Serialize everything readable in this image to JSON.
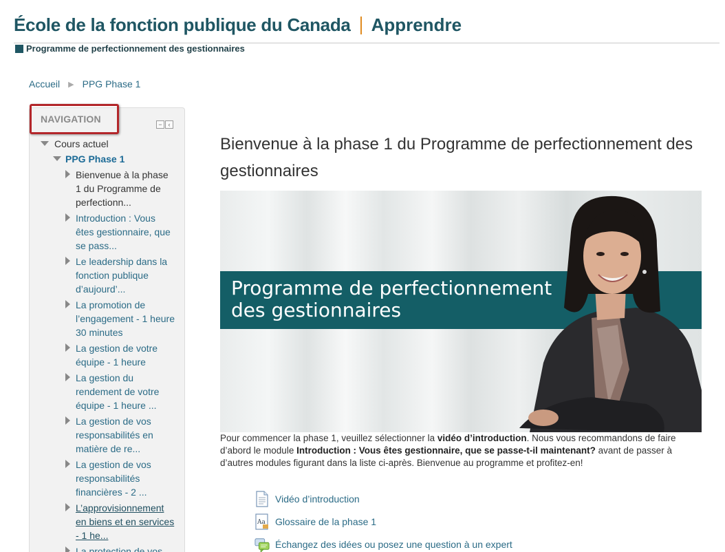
{
  "header": {
    "org_name": "École de la fonction publique du Canada",
    "app_name": "Apprendre",
    "program": "Programme de perfectionnement des gestionnaires"
  },
  "breadcrumb": {
    "home": "Accueil",
    "current": "PPG Phase 1"
  },
  "navigation": {
    "title": "NAVIGATION",
    "current_course_label": "Cours actuel",
    "course_link": "PPG Phase 1",
    "sections": [
      {
        "label": "Bienvenue à la phase 1 du Programme de perfectionn...",
        "style": "dark"
      },
      {
        "label": "Introduction : Vous êtes gestionnaire, que se pass...",
        "style": "link"
      },
      {
        "label": "Le leadership dans la fonction publique d’aujourd’...",
        "style": "link"
      },
      {
        "label": "La promotion de l’engagement - 1 heure 30 minutes",
        "style": "link"
      },
      {
        "label": "La gestion de votre équipe - 1 heure",
        "style": "link"
      },
      {
        "label": "La gestion du rendement de votre équipe - 1 heure ...",
        "style": "link"
      },
      {
        "label": "La gestion de vos responsabilités en matière de re...",
        "style": "link"
      },
      {
        "label": "La gestion de vos responsabilités financières - 2 ...",
        "style": "link"
      },
      {
        "label": "L’approvisionnement en biens et en services - 1 he...",
        "style": "underlined"
      },
      {
        "label": "La protection de vos",
        "style": "link"
      }
    ]
  },
  "main": {
    "title": "Bienvenue à la phase 1 du Programme de perfectionnement des gestionnaires",
    "banner_text_line1": "Programme de perfectionnement",
    "banner_text_line2": "des gestionnaires",
    "intro_part1": "Pour commencer la phase 1, veuillez sélectionner la ",
    "intro_bold1": "vidéo d’introduction",
    "intro_part2": ". Nous vous recommandons de faire d’abord le module ",
    "intro_bold2": "Introduction : Vous êtes gestionnaire, que se passe-t-il maintenant?",
    "intro_part3": " avant de passer à d’autres modules figurant dans la liste ci-après. Bienvenue au programme et profitez-en!",
    "resources": [
      {
        "label": "Vidéo d’introduction",
        "icon": "page-icon"
      },
      {
        "label": "Glossaire de la phase 1",
        "icon": "glossary-icon"
      },
      {
        "label": "Échangez des idées ou posez une question à un expert",
        "icon": "forum-icon"
      }
    ]
  },
  "colors": {
    "brand": "#1f5663",
    "accent": "#e08a1e",
    "link": "#2b6b86",
    "banner_band": "#145e66",
    "highlight_border": "#b3262a"
  }
}
